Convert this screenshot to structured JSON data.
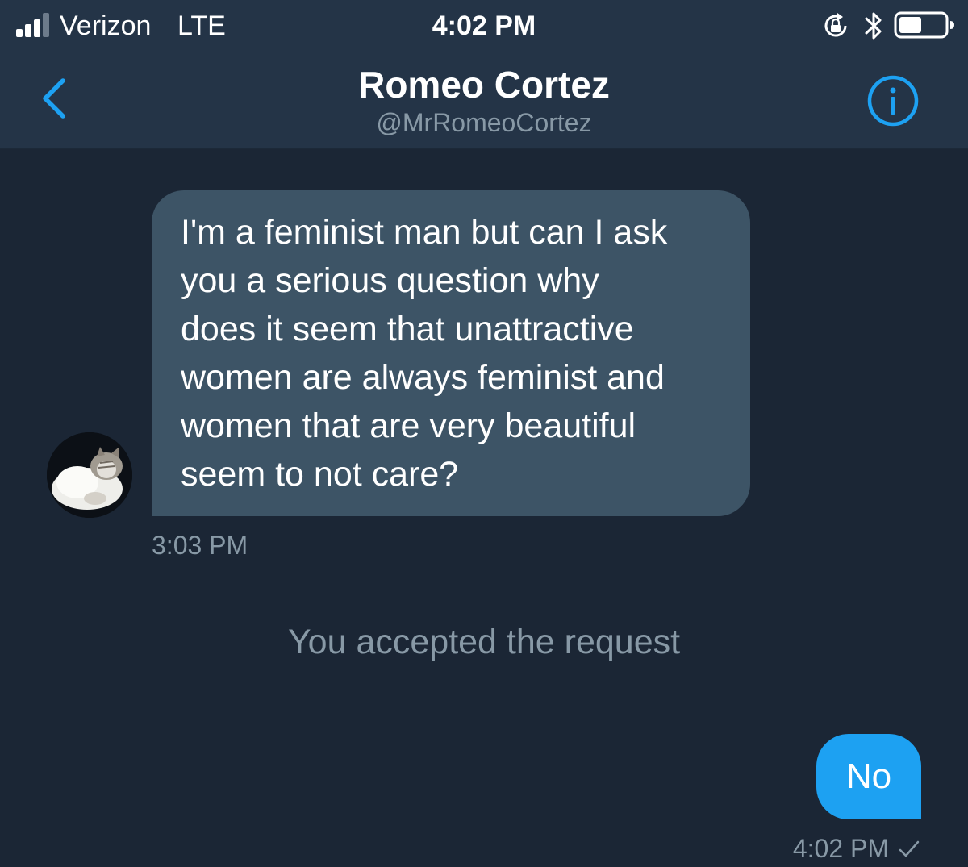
{
  "status_bar": {
    "carrier": "Verizon",
    "network": "LTE",
    "time": "4:02 PM",
    "signal_bars_active": 3,
    "signal_bars_total": 4,
    "battery_level": 0.5,
    "icons": [
      "signal-icon",
      "rotation-lock-icon",
      "bluetooth-icon",
      "battery-icon"
    ]
  },
  "header": {
    "back_icon": "chevron-left-icon",
    "name": "Romeo Cortez",
    "handle": "@MrRomeoCortez",
    "info_icon": "info-icon"
  },
  "conversation": {
    "incoming": {
      "text": "I'm a feminist man but can I ask\nyou a serious question why\ndoes it seem that unattractive\nwomen are always feminist and\nwomen that are very beautiful\nseem to not care?",
      "time": "3:03 PM"
    },
    "system_message": "You accepted the request",
    "outgoing": {
      "text": "No",
      "time": "4:02 PM"
    }
  },
  "colors": {
    "background": "#1b2635",
    "header_background": "#243447",
    "incoming_bubble": "#3d5466",
    "outgoing_bubble": "#1da1f2",
    "accent": "#1da1f2",
    "secondary_text": "#8899a6"
  }
}
